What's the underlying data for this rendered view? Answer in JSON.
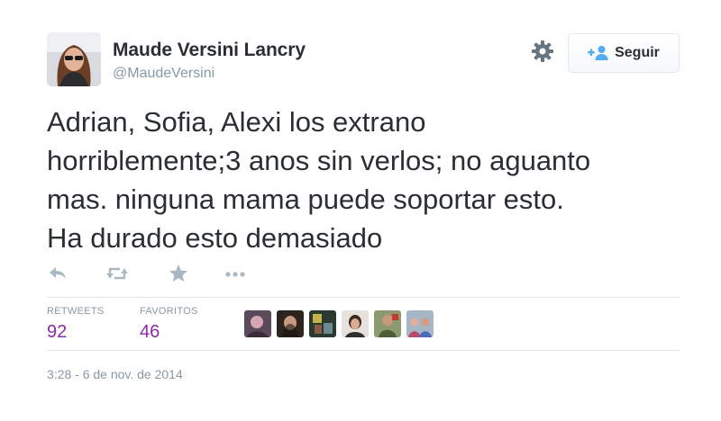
{
  "user": {
    "name": "Maude Versini Lancry",
    "handle": "@MaudeVersini"
  },
  "header": {
    "follow_label": "Seguir",
    "settings_icon": "gear-icon",
    "follow_icon": "add-user-icon"
  },
  "tweet": {
    "lines": [
      "Adrian, Sofia, Alexi los extrano",
      "horriblemente;3 anos sin verlos; no aguanto",
      "mas. ninguna mama puede soportar esto.",
      "Ha durado esto demasiado"
    ]
  },
  "actions": {
    "icons": [
      "reply-icon",
      "retweet-icon",
      "favorite-star-icon",
      "more-icon"
    ]
  },
  "stats": {
    "retweets_label": "RETWEETS",
    "retweets_value": "92",
    "favorites_label": "FAVORITOS",
    "favorites_value": "46"
  },
  "timestamp": "3:28 - 6 de nov. de 2014",
  "colors": {
    "text": "#292f33",
    "muted": "#8899a6",
    "stat_value": "#8e2aa6",
    "follow_icon": "#55acee",
    "divider": "#e1e8ed"
  }
}
